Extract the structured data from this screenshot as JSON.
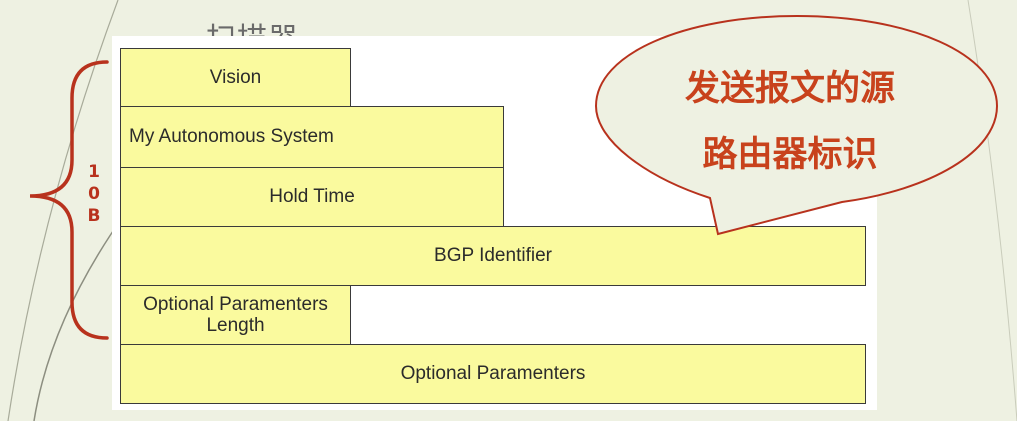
{
  "slide": {
    "partial_title": "扫描器"
  },
  "fields": {
    "vision": "Vision",
    "autonomous_system": "My Autonomous System",
    "hold_time": "Hold Time",
    "bgp_identifier": "BGP Identifier",
    "opt_param_length_line1": "Optional Paramenters",
    "opt_param_length_line2": "Length",
    "opt_params": "Optional Paramenters"
  },
  "brace": {
    "char1": "1",
    "char2": "0",
    "char3": "B"
  },
  "callout": {
    "line1": "发送报文的源",
    "line2": "路由器标识"
  },
  "colors": {
    "field_fill": "#fafa9e",
    "accent_red": "#b8321d",
    "callout_text": "#c8421c"
  }
}
